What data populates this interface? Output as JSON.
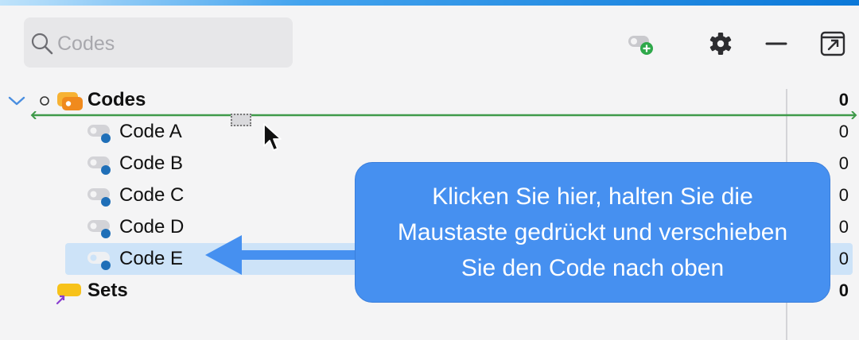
{
  "search": {
    "placeholder": "Codes"
  },
  "toolbar": {
    "icons": [
      "new-code-icon",
      "gear-icon",
      "minimize-icon",
      "popout-icon"
    ]
  },
  "tree": {
    "root": {
      "label": "Codes",
      "count": "0"
    },
    "codes": [
      {
        "label": "Code A",
        "count": "0"
      },
      {
        "label": "Code B",
        "count": "0"
      },
      {
        "label": "Code C",
        "count": "0"
      },
      {
        "label": "Code D",
        "count": "0"
      },
      {
        "label": "Code E",
        "count": "0"
      }
    ],
    "sets": {
      "label": "Sets",
      "count": "0"
    }
  },
  "callout": {
    "text": "Klicken Sie hier, halten Sie die\nMaustaste gedrückt und verschieben\nSie den Code nach oben"
  },
  "colors": {
    "accent": "#0b78d8",
    "callout": "#4690f0",
    "selected": "#cde3f8",
    "insert_line": "#3f9a4a",
    "code_dot": "#1f6fb8",
    "codes_folder": "#f08a1d",
    "sets_folder": "#f7c21a"
  }
}
